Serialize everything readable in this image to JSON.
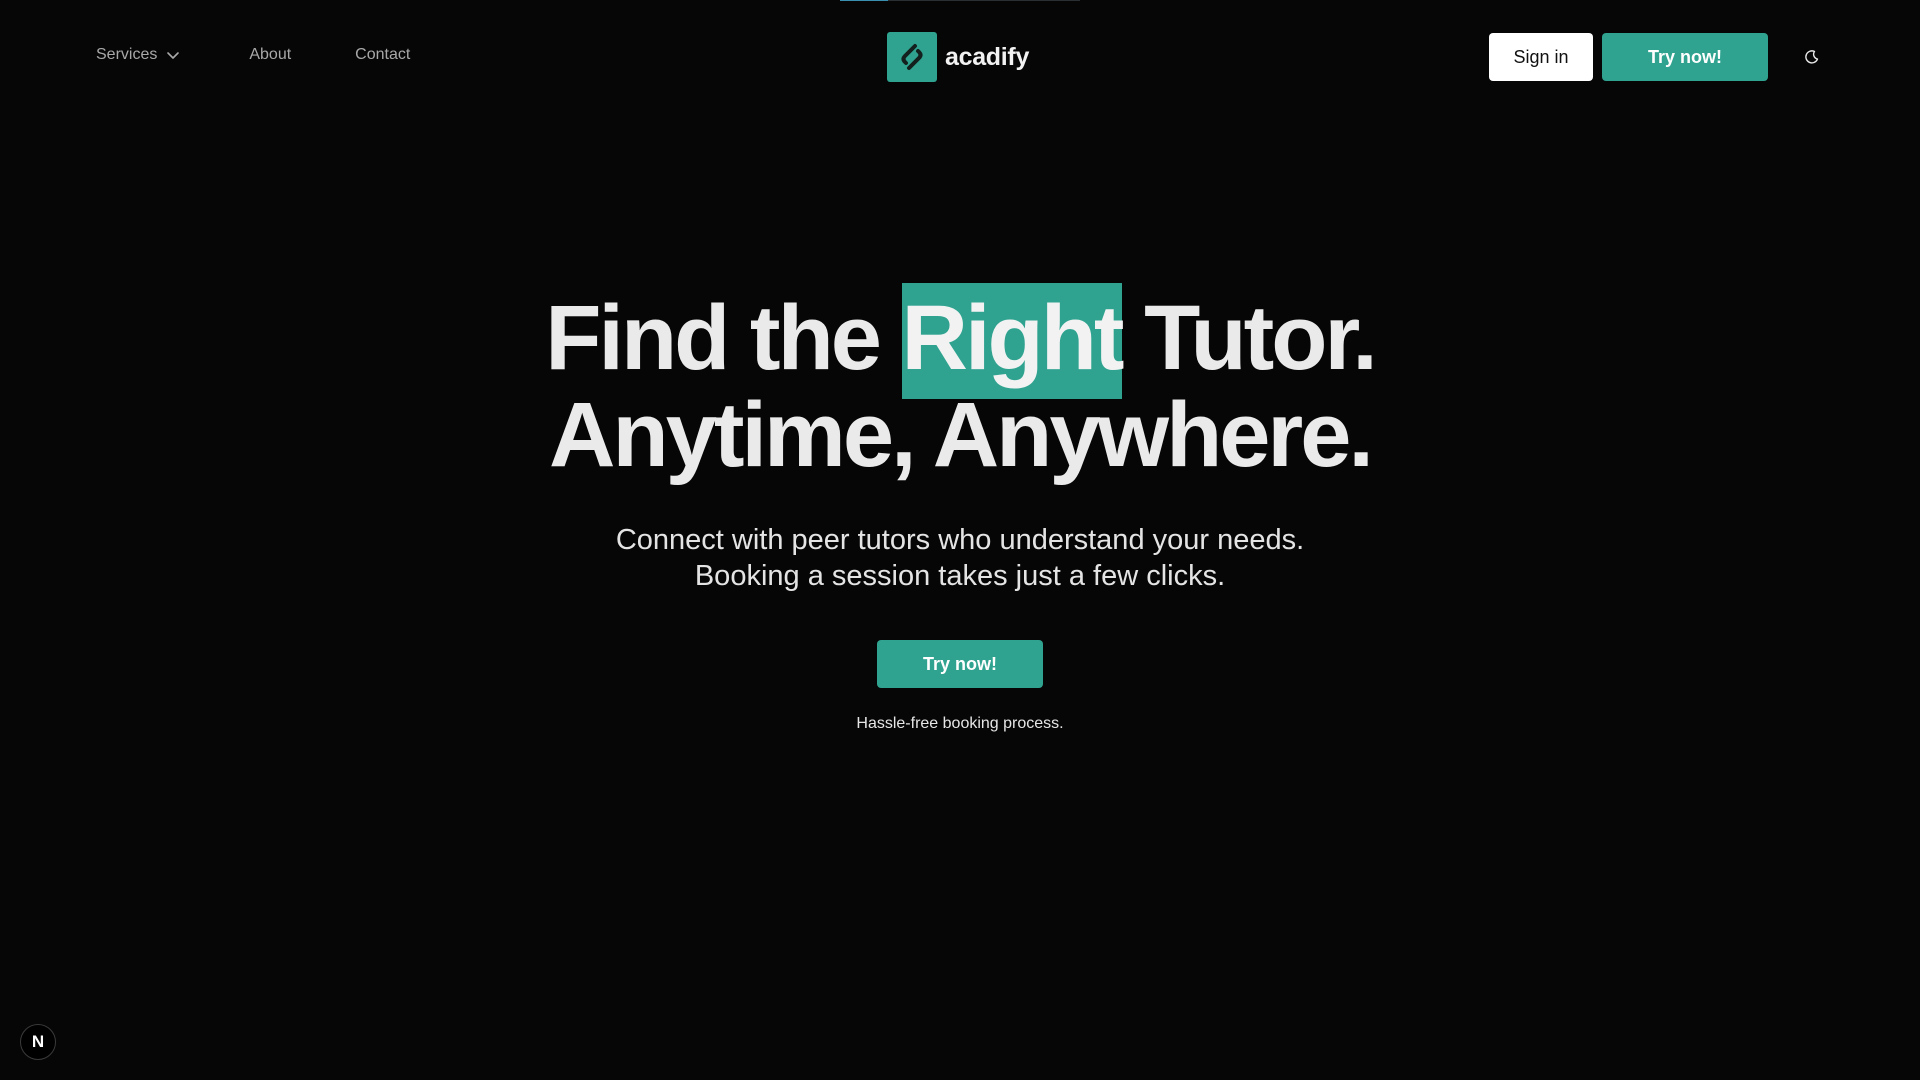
{
  "nav": {
    "links": {
      "services": "Services",
      "about": "About",
      "contact": "Contact"
    },
    "brand_name": "acadify",
    "sign_in_label": "Sign in",
    "try_label": "Try now!"
  },
  "hero": {
    "headline_part1": "Find the ",
    "headline_highlight": "Right",
    "headline_part2": " Tutor.",
    "headline_line2": "Anytime, Anywhere.",
    "subhead_line1": "Connect with peer tutors who understand your needs.",
    "subhead_line2": "Booking a session takes just a few clicks.",
    "cta_label": "Try now!",
    "tagline": "Hassle-free booking process."
  },
  "dev_badge": "N",
  "colors": {
    "background": "#060606",
    "accent": "#2fa390",
    "text": "#eaeaea"
  },
  "icons": {
    "services_dropdown": "chevron-down-icon",
    "brand_logo": "link-icon",
    "theme_toggle": "moon-icon"
  }
}
